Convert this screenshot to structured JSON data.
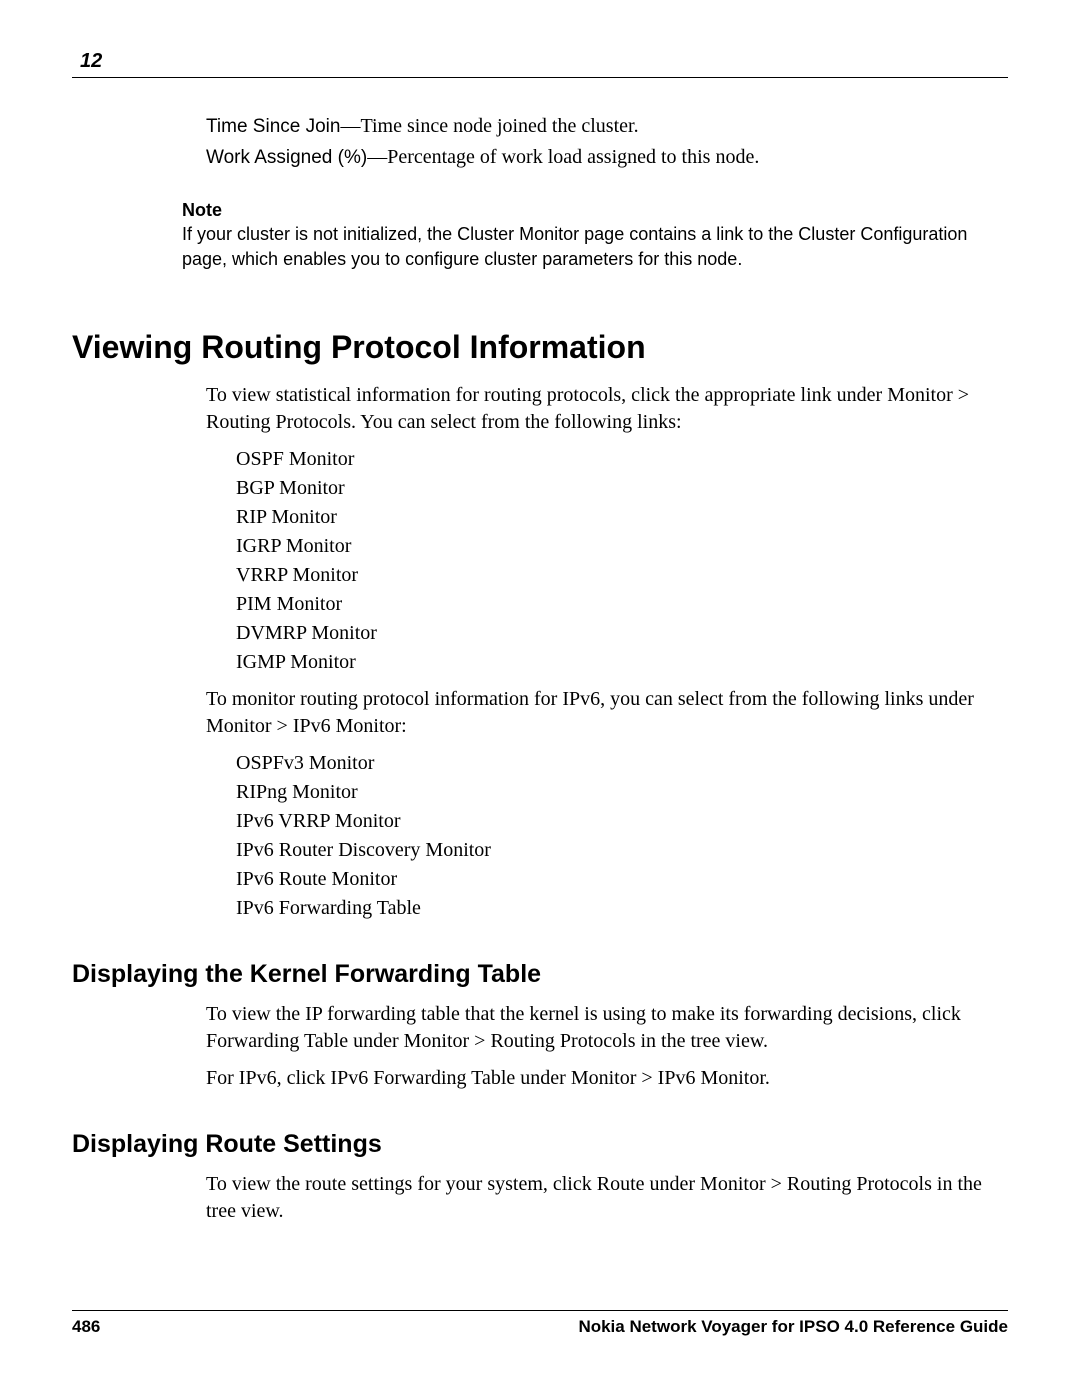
{
  "header": {
    "chapter_number": "12"
  },
  "deflist": [
    {
      "term": "Time Since Join",
      "def": "—Time since node joined the cluster."
    },
    {
      "term": "Work Assigned (%)",
      "def": "—Percentage of work load assigned to this node."
    }
  ],
  "note": {
    "label": "Note",
    "text": "If your cluster is not initialized, the Cluster Monitor page contains a link to the Cluster Configuration page, which enables you to configure cluster parameters for this node."
  },
  "section1": {
    "title": "Viewing Routing Protocol Information",
    "intro1": "To view statistical information for routing protocols, click the appropriate link under Monitor > Routing Protocols. You can select from the following links:",
    "list1": [
      "OSPF Monitor",
      "BGP Monitor",
      "RIP Monitor",
      "IGRP Monitor",
      "VRRP Monitor",
      "PIM Monitor",
      "DVMRP Monitor",
      "IGMP Monitor"
    ],
    "intro2": "To monitor routing protocol information for IPv6, you can select from the following links under Monitor > IPv6 Monitor:",
    "list2": [
      "OSPFv3 Monitor",
      "RIPng Monitor",
      "IPv6 VRRP Monitor",
      "IPv6 Router Discovery Monitor",
      "IPv6 Route Monitor",
      "IPv6 Forwarding Table"
    ]
  },
  "section2": {
    "title": "Displaying the Kernel Forwarding Table",
    "p1": "To view the IP forwarding table that the kernel is using to make its forwarding decisions, click Forwarding Table under Monitor > Routing Protocols in the tree view.",
    "p2": "For IPv6, click IPv6 Forwarding Table under Monitor > IPv6 Monitor."
  },
  "section3": {
    "title": "Displaying Route Settings",
    "p1": "To view the route settings for your system, click Route under Monitor > Routing Protocols in the tree view."
  },
  "footer": {
    "page_number": "486",
    "book_title": "Nokia Network Voyager for IPSO 4.0 Reference Guide"
  }
}
